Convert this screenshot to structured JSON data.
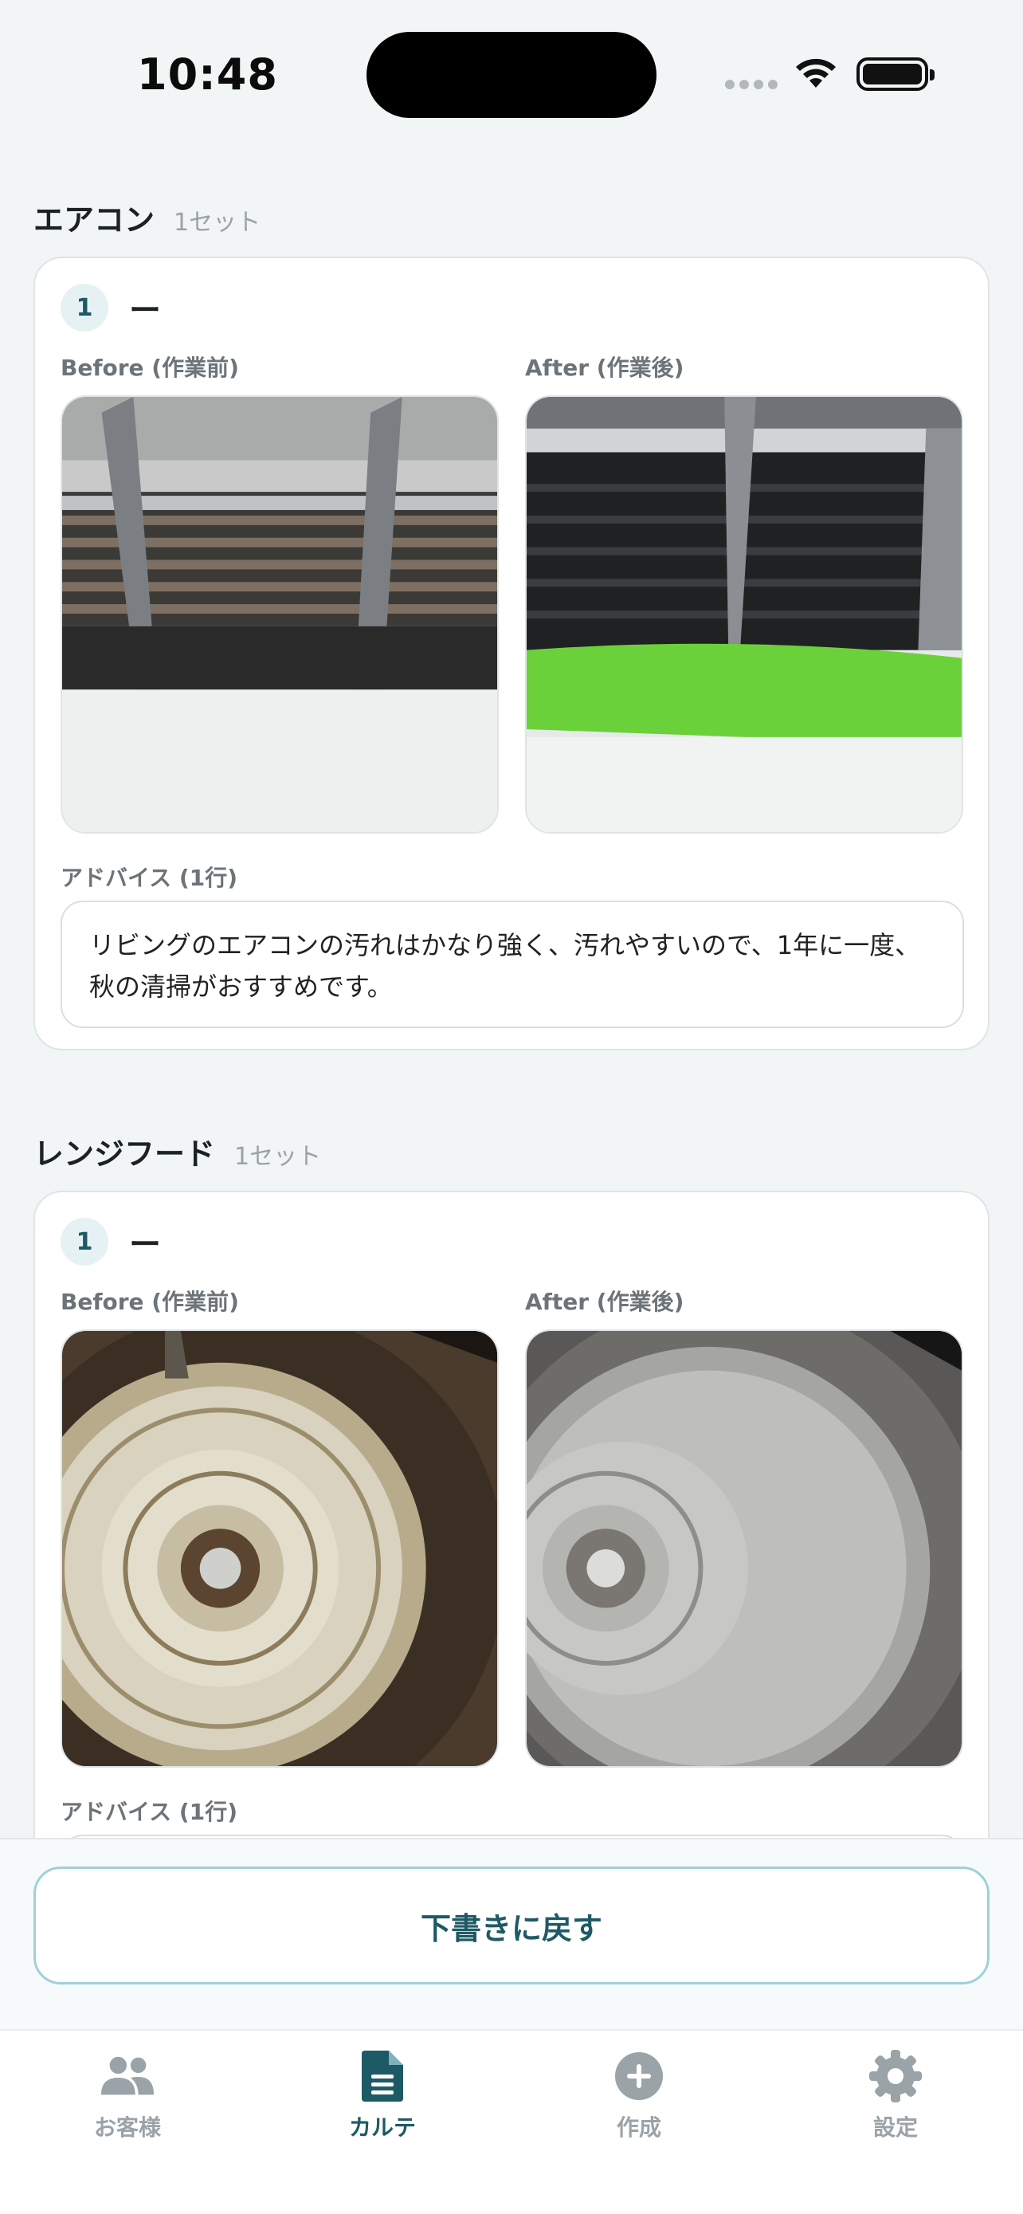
{
  "status_bar": {
    "time": "10:48"
  },
  "sections": [
    {
      "name": "エアコン",
      "count": "1セット",
      "item_number": "1",
      "item_title": "ー",
      "before_label": "Before (作業前)",
      "after_label": "After (作業後)",
      "advice_label": "アドバイス (1行)",
      "advice_text": "リビングのエアコンの汚れはかなり強く、汚れやすいので、1年に一度、秋の清掃がおすすめです。"
    },
    {
      "name": "レンジフード",
      "count": "1セット",
      "item_number": "1",
      "item_title": "ー",
      "before_label": "Before (作業前)",
      "after_label": "After (作業後)",
      "advice_label": "アドバイス (1行)"
    }
  ],
  "actions": {
    "back_to_draft": "下書きに戻す"
  },
  "tabbar": {
    "items": [
      {
        "label": "お客様",
        "icon": "users-icon"
      },
      {
        "label": "カルテ",
        "icon": "document-icon",
        "active": true
      },
      {
        "label": "作成",
        "icon": "plus-circle-icon"
      },
      {
        "label": "設定",
        "icon": "gear-icon"
      }
    ]
  },
  "colors": {
    "accent": "#1e5a66",
    "accent_border": "#9fd0da",
    "inactive": "#9aa3a7"
  }
}
